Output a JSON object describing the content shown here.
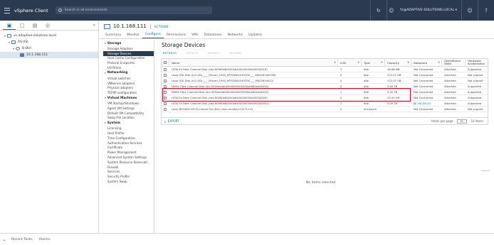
{
  "header": {
    "app_title": "vSphere Client",
    "search_placeholder": "Search in all environments",
    "user": "Y.I@ADAPTIVE-SOLUTIONS.LOCAL ▾",
    "icons": [
      "menu-icon",
      "refresh-icon",
      "user-icon",
      "help-icon"
    ]
  },
  "nav": {
    "tabs": [
      "hosts-and-clusters-icon",
      "vms-and-templates-icon",
      "storage-icon",
      "networking-icon"
    ],
    "tree": [
      {
        "label": "vc.adaptive-solutions.local",
        "depth": 0,
        "icon": "vcenter-icon"
      },
      {
        "label": "AS-VSI",
        "depth": 1,
        "icon": "datacenter-icon"
      },
      {
        "label": "B-DUI",
        "depth": 2,
        "icon": "cluster-icon"
      },
      {
        "label": "10.1.168.111",
        "depth": 3,
        "icon": "host-icon",
        "selected": true
      }
    ]
  },
  "object": {
    "name": "10.1.168.111",
    "actions": "ACTIONS",
    "tabs": [
      "Summary",
      "Monitor",
      "Configure",
      "Permissions",
      "VMs",
      "Datastores",
      "Networks",
      "Updates"
    ],
    "active_tab": "Configure"
  },
  "config_menu": [
    {
      "section": "Storage",
      "items": [
        "Storage Adapters",
        "Storage Devices",
        "Host Cache Configuration",
        "Protocol Endpoints",
        "I/O Filters"
      ]
    },
    {
      "section": "Networking",
      "items": [
        "Virtual switches",
        "VMkernel adapters",
        "Physical adapters",
        "TCP/IP configuration"
      ]
    },
    {
      "section": "Virtual Machines",
      "items": [
        "VM Startup/Shutdown",
        "Agent VM Settings",
        "Default VM Compatibility",
        "Swap File Location"
      ]
    },
    {
      "section": "System",
      "items": [
        "Licensing",
        "Host Profile",
        "Time Configuration",
        "Authentication Services",
        "Certificate",
        "Power Management",
        "Advanced System Settings",
        "System Resource Reservati...",
        "Firewall",
        "Services",
        "Security Profile",
        "System Swap"
      ]
    }
  ],
  "config_active": "Storage Devices",
  "main": {
    "title": "Storage Devices",
    "toolbar": {
      "refresh": "REFRESH",
      "attach": "ATTACH",
      "detach": "DETACH",
      "rename": "RENAME"
    },
    "columns": [
      "Name",
      "LUN",
      "Type",
      "Capacity",
      "Datastore",
      "Operational State",
      "Hardware Acceleration"
    ],
    "rows": [
      {
        "name": "HITACHI Fibre Channel Disk (naa.60060e80000eb400000050e00000018)",
        "lun": "3",
        "type": "disk",
        "capacity": "48.88 MB",
        "datastore": "Not Consumed",
        "state": "Attached",
        "hw": "Supported"
      },
      {
        "name": "Local ATA Disk (t10.ATA_____Micron_5300_MTFDDAV240TDS____MSA26340F9M)",
        "lun": "0",
        "type": "disk",
        "capacity": "223.57 GB",
        "datastore": "Not Consumed",
        "state": "Attached",
        "hw": "Not support"
      },
      {
        "name": "Local ATA Disk (t10.ATA_____Micron_5300_MTFDDAV240TDS____MSV2634012)",
        "lun": "0",
        "type": "disk",
        "capacity": "223.57 GB",
        "datastore": "Not Consumed",
        "state": "Attached",
        "hw": "Not support"
      },
      {
        "name": "NVMe Fibre Channel Disk (eui.0050ed4d00000000000000e0080e4d0002)",
        "lun": "0",
        "type": "disk",
        "capacity": "5.00 TB",
        "datastore": "Not Consumed",
        "state": "Attached",
        "hw": "Supported"
      },
      {
        "name": "NVMe Fibre Channel Disk (eui.0050ed4d00000000000000e0080e4d0003)",
        "lun": "1",
        "type": "disk",
        "capacity": "5.00 TB",
        "datastore": "Not Consumed",
        "state": "Attached",
        "hw": "Supported"
      },
      {
        "name": "HITACHI Fibre Channel Disk (naa.60060e80000eb400000050e00000004)",
        "lun": "0",
        "type": "disk",
        "capacity": "32.00 GB",
        "datastore": "Not Consumed",
        "state": "Attached",
        "hw": "Supported"
      },
      {
        "name": "HITACHI Fibre Channel Disk (naa.60060e80000eb400000050e000000001)",
        "lun": "2",
        "type": "disk",
        "capacity": "5.00 TB",
        "datastore": "VSI-DS-02",
        "state": "Attached",
        "hw": "Supported"
      },
      {
        "name": "Local BROADCOM Enclosure Svc Dev (mpx.vmhba4:C0:T1:L0)",
        "lun": "0",
        "type": "enclosure",
        "capacity": "",
        "datastore": "Not Consumed",
        "state": "Attached",
        "hw": "Not support"
      }
    ],
    "export": "EXPORT",
    "items_per_page_label": "Items per page",
    "items_per_page": "35",
    "item_count": "10 items",
    "empty_message": "No items selected"
  },
  "bottom": {
    "tabs": [
      "Recent Tasks",
      "Alarms"
    ]
  }
}
